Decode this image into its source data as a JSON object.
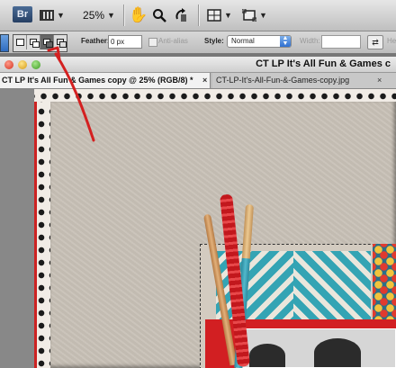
{
  "app_bar": {
    "bridge_label": "Br",
    "zoom_value": "25%",
    "icons": [
      "bridge-icon",
      "filmstrip-icon",
      "hand-icon",
      "zoom-icon",
      "rotate-view-icon",
      "arrange-documents-icon",
      "screen-mode-icon"
    ]
  },
  "options_bar": {
    "feather_label": "Feather:",
    "feather_value": "0 px",
    "anti_alias_label": "Anti-alias",
    "style_label": "Style:",
    "style_value": "Normal",
    "width_label": "Width:",
    "height_label": "He"
  },
  "window": {
    "title": "CT LP It's All Fun & Games c"
  },
  "tabs": [
    {
      "label": "CT LP It's All Fun & Games copy @ 25% (RGB/8) *",
      "active": true
    },
    {
      "label": "CT-LP-It's-All-Fun-&-Games-copy.jpg",
      "active": false
    }
  ],
  "close_glyph": "×",
  "colors": {
    "annotation_arrow": "#d42020",
    "selection_active_blue": "#2e6fd0",
    "chevron_teal": "#34a4b4",
    "frame_red": "#d21f22"
  }
}
